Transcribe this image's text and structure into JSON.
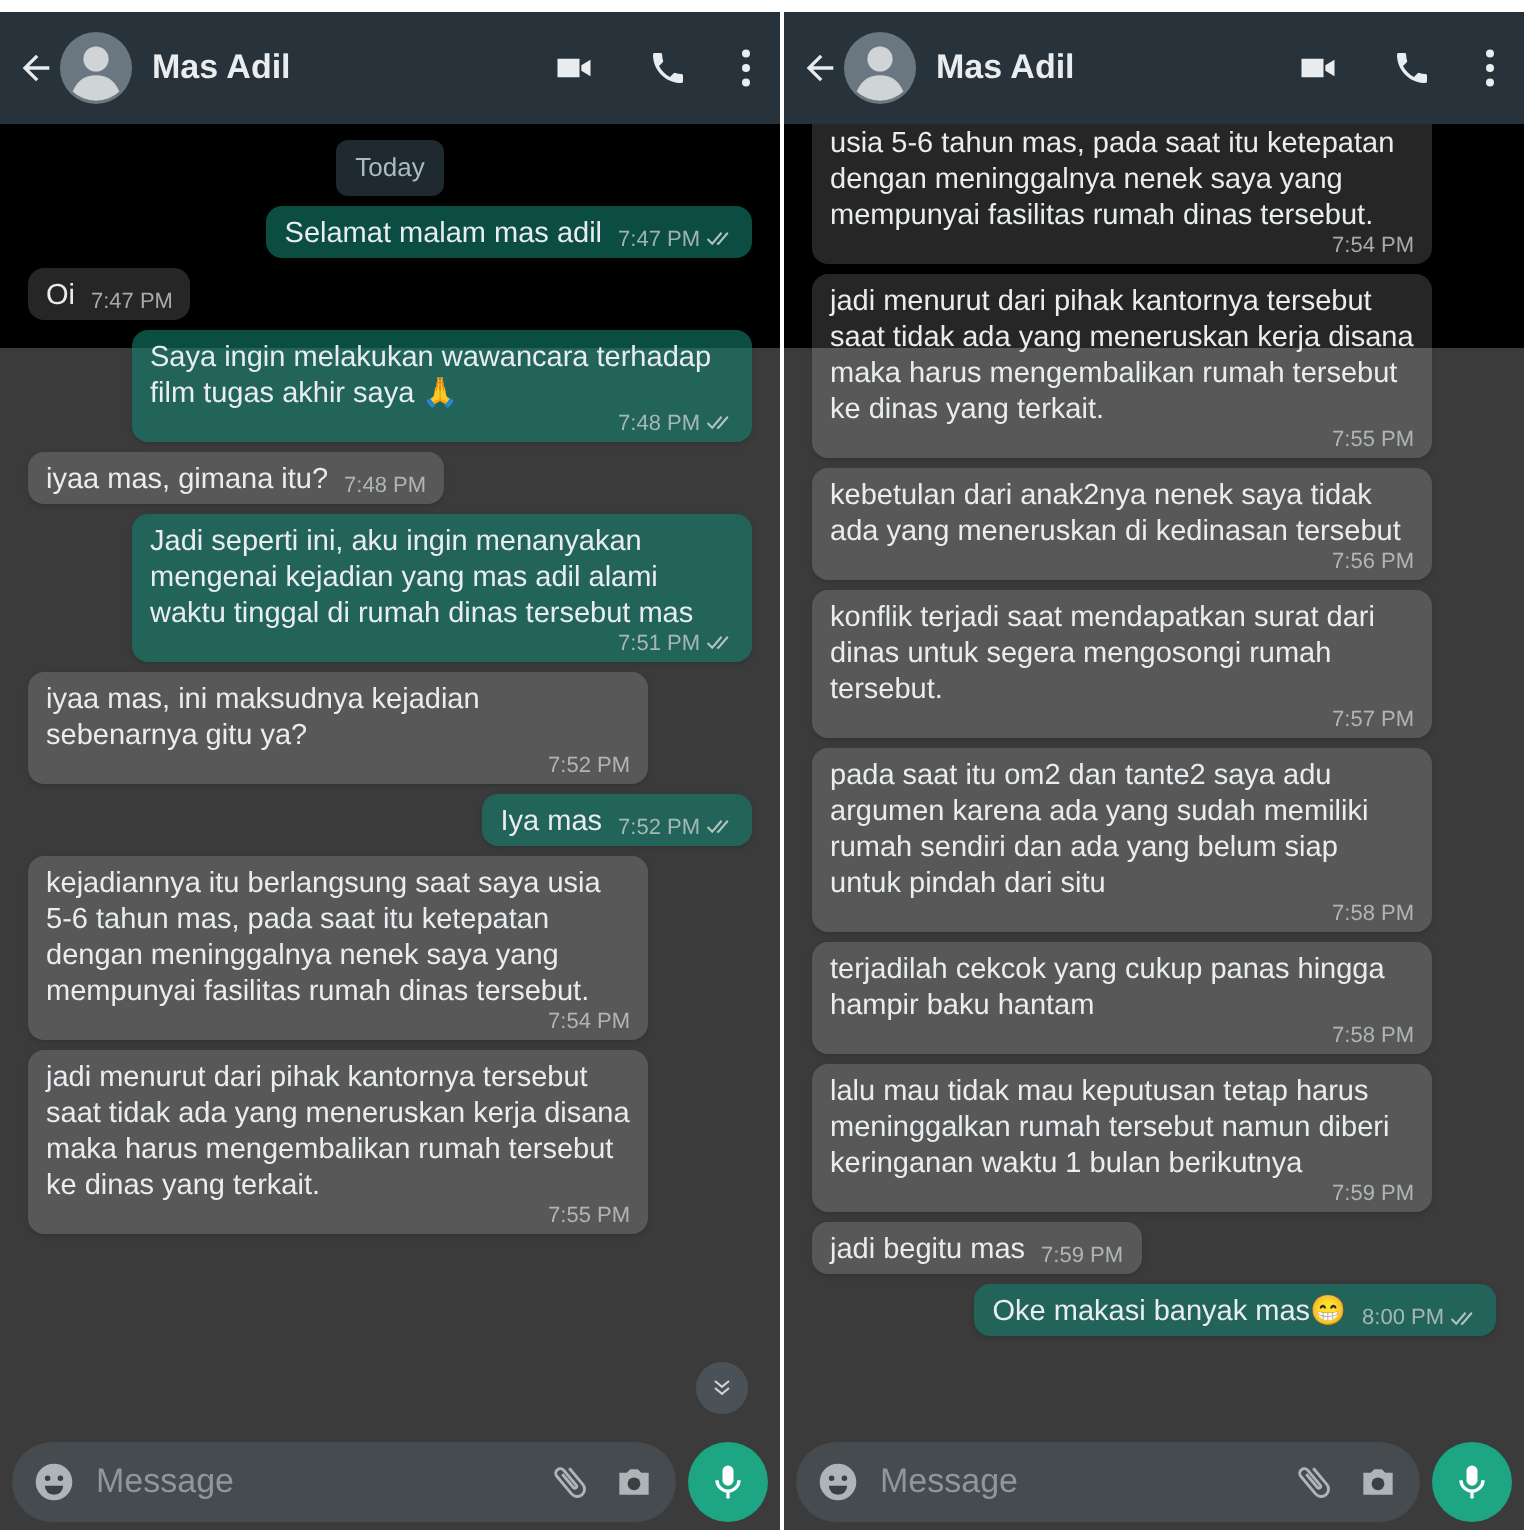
{
  "panels": [
    {
      "header": {
        "contact": "Mas Adil"
      },
      "scroll_down_button": true,
      "composer": {
        "placeholder": "Message"
      },
      "messages": [
        {
          "kind": "date",
          "text": "Today"
        },
        {
          "kind": "out",
          "text": "Selamat malam mas adil",
          "time": "7:47 PM",
          "read": false
        },
        {
          "kind": "in",
          "text": "Oi",
          "time": "7:47 PM"
        },
        {
          "kind": "out",
          "text": "Saya ingin melakukan wawancara terhadap film tugas akhir saya 🙏",
          "time": "7:48 PM",
          "read": false
        },
        {
          "kind": "in",
          "text": "iyaa mas, gimana itu?",
          "time": "7:48 PM"
        },
        {
          "kind": "out",
          "text": "Jadi seperti ini, aku ingin menanyakan mengenai kejadian yang mas adil alami waktu tinggal di rumah dinas tersebut mas",
          "time": "7:51 PM",
          "read": false
        },
        {
          "kind": "in",
          "text": "iyaa mas, ini maksudnya kejadian sebenarnya gitu ya?",
          "time": "7:52 PM"
        },
        {
          "kind": "out",
          "text": "Iya mas",
          "time": "7:52 PM",
          "read": false
        },
        {
          "kind": "in",
          "text": "kejadiannya itu berlangsung saat saya usia 5-6 tahun mas, pada saat itu ketepatan dengan meninggalnya nenek saya yang mempunyai fasilitas rumah dinas tersebut.",
          "time": "7:54 PM"
        },
        {
          "kind": "in",
          "text": "jadi menurut dari pihak kantornya tersebut saat tidak ada yang meneruskan kerja disana maka harus mengembalikan rumah tersebut ke dinas yang terkait.",
          "time": "7:55 PM"
        }
      ]
    },
    {
      "header": {
        "contact": "Mas Adil"
      },
      "scroll_down_button": false,
      "composer": {
        "placeholder": "Message"
      },
      "messages": [
        {
          "kind": "in",
          "text": "usia 5-6 tahun mas, pada saat itu ketepatan dengan meninggalnya nenek saya yang mempunyai fasilitas rumah dinas tersebut.",
          "time": "7:54 PM"
        },
        {
          "kind": "in",
          "text": "jadi menurut dari pihak kantornya tersebut saat tidak ada yang meneruskan kerja disana maka harus mengembalikan rumah tersebut ke dinas yang terkait.",
          "time": "7:55 PM"
        },
        {
          "kind": "in",
          "text": "kebetulan dari anak2nya nenek saya tidak ada yang meneruskan di kedinasan tersebut",
          "time": "7:56 PM"
        },
        {
          "kind": "in",
          "text": "konflik terjadi saat mendapatkan surat dari dinas untuk segera mengosongi rumah tersebut.",
          "time": "7:57 PM"
        },
        {
          "kind": "in",
          "text": "pada saat itu om2 dan tante2 saya adu argumen karena ada yang sudah memiliki rumah sendiri dan ada yang belum siap untuk pindah dari situ",
          "time": "7:58 PM"
        },
        {
          "kind": "in",
          "text": "terjadilah cekcok yang cukup panas hingga hampir baku hantam",
          "time": "7:58 PM"
        },
        {
          "kind": "in",
          "text": "lalu mau tidak mau keputusan tetap harus meninggalkan rumah tersebut namun diberi keringanan waktu 1 bulan berikutnya",
          "time": "7:59 PM"
        },
        {
          "kind": "in",
          "text": "jadi begitu mas",
          "time": "7:59 PM"
        },
        {
          "kind": "out",
          "text": "Oke makasi banyak mas😁",
          "time": "8:00 PM",
          "read": false
        }
      ]
    }
  ]
}
